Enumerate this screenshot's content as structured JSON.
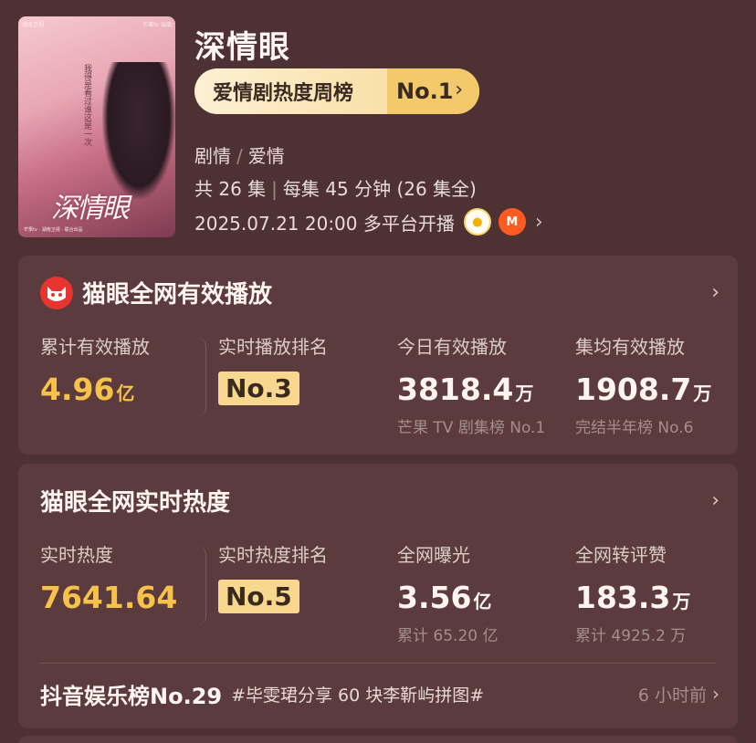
{
  "show": {
    "title": "深情眼",
    "rank_label": "爱情剧热度周榜",
    "rank_value": "No.1",
    "genre": [
      "剧情",
      "爱情"
    ],
    "episodes": "共 26 集",
    "episode_length": "每集 45 分钟 (26 集全)",
    "air_time": "2025.07.21 20:00 多平台开播",
    "platforms": [
      "hunan-tv-icon",
      "mango-tv-icon"
    ]
  },
  "poster": {
    "title_text": "深情眼",
    "vertical_text": "我得是看过谁这是一次",
    "logo_left": "湖南卫视",
    "logo_right": "芒果tv 出品",
    "footer": "芒果tv · 湖南卫视 · 联合出品"
  },
  "card1": {
    "title": "猫眼全网有效播放",
    "stats": [
      {
        "label": "累计有效播放",
        "value": "4.96",
        "unit": "亿"
      },
      {
        "label": "实时播放排名",
        "value": "No.3"
      },
      {
        "label": "今日有效播放",
        "value": "3818.4",
        "unit": "万",
        "sub": "芒果 TV 剧集榜 No.1"
      },
      {
        "label": "集均有效播放",
        "value": "1908.7",
        "unit": "万",
        "sub": "完结半年榜 No.6"
      }
    ]
  },
  "card2": {
    "title": "猫眼全网实时热度",
    "stats": [
      {
        "label": "实时热度",
        "value": "7641.64"
      },
      {
        "label": "实时热度排名",
        "value": "No.5"
      },
      {
        "label": "全网曝光",
        "value": "3.56",
        "unit": "亿",
        "sub": "累计 65.20 亿"
      },
      {
        "label": "全网转评赞",
        "value": "183.3",
        "unit": "万",
        "sub": "累计 4925.2 万"
      }
    ],
    "douyin": {
      "title": "抖音娱乐榜No.29",
      "topic": "#毕雯珺分享 60 块李靳屿拼图#",
      "time": "6 小时前"
    }
  },
  "colors": {
    "background": "#4e3133",
    "card": "#5b3b3d",
    "gold": "#f7c24a",
    "badge": "#f8d88e",
    "maoyan_red": "#e8342f"
  }
}
